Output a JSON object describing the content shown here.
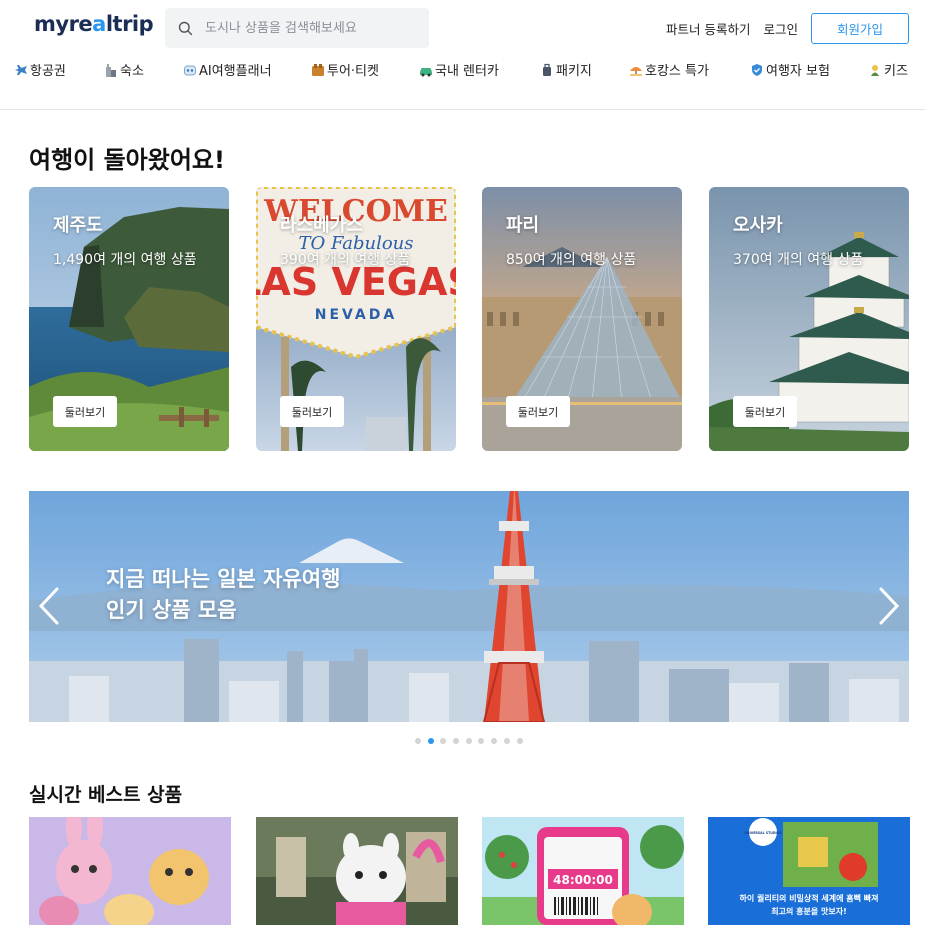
{
  "header": {
    "logo": {
      "part1": "myre",
      "part2": "a",
      "part3": "ltrip"
    },
    "search_placeholder": "도시나 상품을 검색해보세요",
    "partner_label": "파트너 등록하기",
    "login_label": "로그인",
    "signup_label": "회원가입"
  },
  "nav": [
    {
      "label": "항공권",
      "icon": "airplane-icon"
    },
    {
      "label": "숙소",
      "icon": "building-icon"
    },
    {
      "label": "AI여행플래너",
      "icon": "robot-icon"
    },
    {
      "label": "투어·티켓",
      "icon": "ticket-icon"
    },
    {
      "label": "국내 렌터카",
      "icon": "car-icon"
    },
    {
      "label": "패키지",
      "icon": "luggage-icon"
    },
    {
      "label": "호캉스 특가",
      "icon": "umbrella-icon"
    },
    {
      "label": "여행자 보험",
      "icon": "shield-icon"
    },
    {
      "label": "키즈",
      "icon": "kids-icon"
    }
  ],
  "section1": {
    "title": "여행이 돌아왔어요!",
    "cards": [
      {
        "name": "제주도",
        "count": "1,490여 개의 여행 상품",
        "button": "둘러보기"
      },
      {
        "name": "라스베가스",
        "count": "390여 개의 여행 상품",
        "button": "둘러보기",
        "sign_top": "WELCOME",
        "sign_mid": "TO Fabulous",
        "sign_main": "LAS VEGAS",
        "sign_bottom": "NEVADA"
      },
      {
        "name": "파리",
        "count": "850여 개의 여행 상품",
        "button": "둘러보기"
      },
      {
        "name": "오사카",
        "count": "370여 개의 여행 상품",
        "button": "둘러보기"
      }
    ]
  },
  "banner": {
    "line1": "지금 떠나는 일본 자유여행",
    "line2": "인기 상품 모음",
    "slide_count": 9,
    "active_slide": 2
  },
  "section2": {
    "title": "실시간 베스트 상품",
    "products": [
      {
        "text": ""
      },
      {
        "text": ""
      },
      {
        "text": "48:00:00"
      },
      {
        "text1": "UNIVERSAL STUDIOS",
        "text2": "하이 퀄리티의 비밀상적 세계에 흠뻑 빠져",
        "text3": "최고의 흥분을 맛보자!"
      }
    ]
  },
  "colors": {
    "accent": "#2b96ed",
    "brand_dark": "#1b2d55"
  }
}
